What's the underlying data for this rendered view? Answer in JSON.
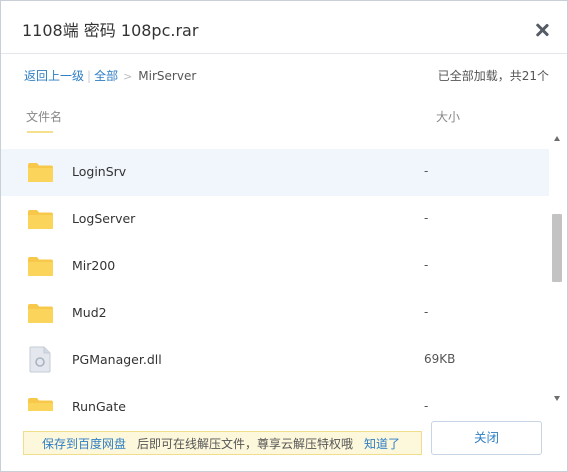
{
  "window": {
    "title": "1108端 密码 108pc.rar"
  },
  "breadcrumb": {
    "back": "返回上一级",
    "separator": "|",
    "all": "全部",
    "arrow": ">",
    "current": "MirServer"
  },
  "status": {
    "loaded": "已全部加载，共21个"
  },
  "columns": {
    "name": "文件名",
    "size": "大小"
  },
  "files": [
    {
      "name": "LoginSrv",
      "size": "-",
      "icon": "folder-icon",
      "selected": true
    },
    {
      "name": "LogServer",
      "size": "-",
      "icon": "folder-icon",
      "selected": false
    },
    {
      "name": "Mir200",
      "size": "-",
      "icon": "folder-icon",
      "selected": false
    },
    {
      "name": "Mud2",
      "size": "-",
      "icon": "folder-icon",
      "selected": false
    },
    {
      "name": "PGManager.dll",
      "size": "69KB",
      "icon": "file-icon",
      "selected": false
    },
    {
      "name": "RunGate",
      "size": "-",
      "icon": "folder-icon",
      "selected": false
    }
  ],
  "banner": {
    "save": "保存到百度网盘",
    "text": "后即可在线解压文件，尊享云解压特权哦",
    "got_it": "知道了"
  },
  "buttons": {
    "close": "关闭"
  },
  "colors": {
    "link": "#2e7ec4",
    "folder": "#f7c84a",
    "selected_row": "#f1f6fc",
    "banner_bg": "#fdf8dc"
  }
}
